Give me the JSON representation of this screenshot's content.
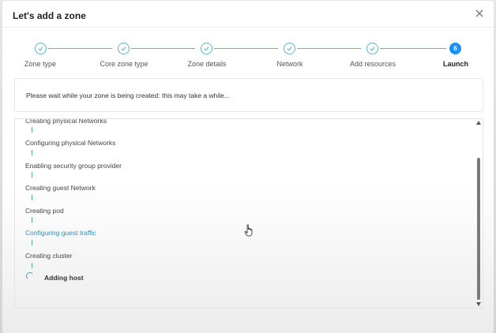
{
  "modal": {
    "title": "Let's add a zone"
  },
  "steps": [
    {
      "label": "Zone type",
      "status": "done"
    },
    {
      "label": "Core zone type",
      "status": "done"
    },
    {
      "label": "Zone details",
      "status": "done"
    },
    {
      "label": "Network",
      "status": "done"
    },
    {
      "label": "Add resources",
      "status": "done"
    },
    {
      "label": "Launch",
      "status": "active",
      "number": "6"
    }
  ],
  "info": {
    "message": "Please wait while your zone is being created: this may take a while..."
  },
  "log": {
    "items": [
      "Creating physical Networks",
      "Configuring physical Networks",
      "Enabling security group provider",
      "Creating guest Network",
      "Creating pod",
      "Configuring guest traffic",
      "Creating cluster"
    ],
    "current": "Adding host"
  },
  "colors": {
    "accent": "#1890ff",
    "step_line": "#62b6c9",
    "highlight_text": "#2f8fb4"
  },
  "icons": {
    "close": "close-icon",
    "check": "check-icon",
    "spinner": "loading-spinner-icon"
  }
}
